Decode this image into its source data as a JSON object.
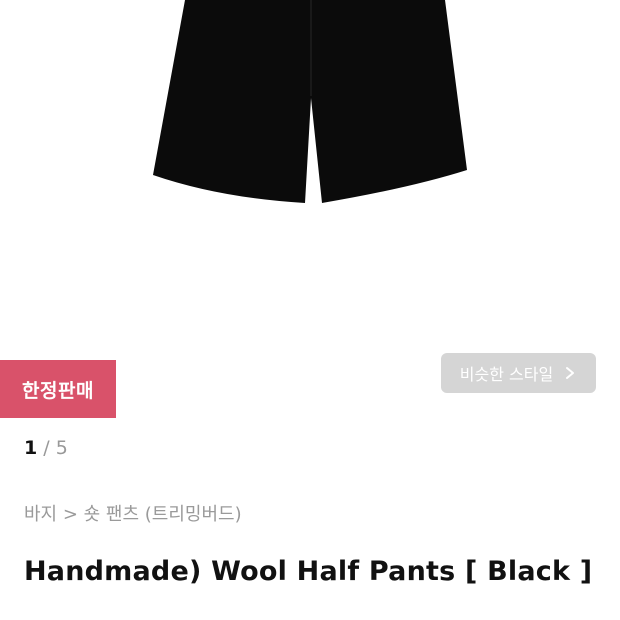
{
  "badge": {
    "label": "한정판매"
  },
  "similar_button": {
    "label": "비슷한 스타일",
    "icon": "chevron-right-icon"
  },
  "pager": {
    "current": "1",
    "separator": "/",
    "total": "5"
  },
  "breadcrumb": {
    "text": "바지 > 숏 팬츠 (트리밍버드)"
  },
  "product": {
    "title": "Handmade) Wool Half Pants [ Black ]"
  },
  "colors": {
    "badge_bg": "#d9526a",
    "button_bg": "#d5d5d5",
    "pants": "#0b0b0b"
  }
}
